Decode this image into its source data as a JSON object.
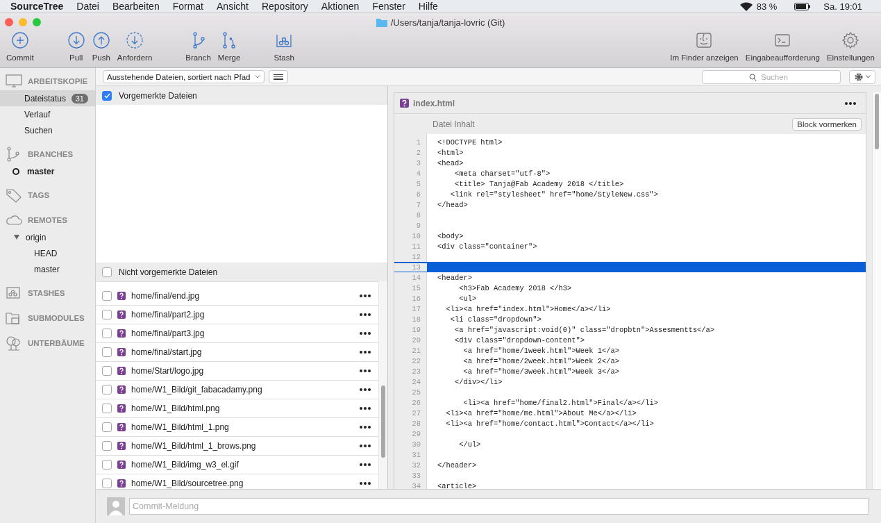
{
  "menubar": {
    "app": "SourceTree",
    "menus": [
      "Datei",
      "Bearbeiten",
      "Format",
      "Ansicht",
      "Repository",
      "Aktionen",
      "Fenster",
      "Hilfe"
    ],
    "battery": "83 %",
    "clock": "Sa. 19:01"
  },
  "window": {
    "title": "/Users/tanja/tanja-lovric (Git)"
  },
  "toolbar": {
    "left": [
      {
        "kind": "commit",
        "label": "Commit"
      },
      {
        "kind": "gap"
      },
      {
        "kind": "pull",
        "label": "Pull"
      },
      {
        "kind": "push",
        "label": "Push"
      },
      {
        "kind": "fetch",
        "label": "Anfordern"
      },
      {
        "kind": "gap"
      },
      {
        "kind": "branch",
        "label": "Branch"
      },
      {
        "kind": "merge",
        "label": "Merge"
      },
      {
        "kind": "gap"
      },
      {
        "kind": "stash",
        "label": "Stash"
      }
    ],
    "right": [
      {
        "kind": "finder",
        "label": "Im Finder anzeigen"
      },
      {
        "kind": "terminal",
        "label": "Eingabeaufforderung"
      },
      {
        "kind": "settings",
        "label": "Einstellungen"
      }
    ]
  },
  "sidebar": [
    {
      "kind": "workspace",
      "title": "ARBEITSKOPIE",
      "items": [
        {
          "label": "Dateistatus",
          "badge": "31",
          "selected": true
        },
        {
          "label": "Verlauf",
          "selected": false
        },
        {
          "label": "Suchen",
          "selected": false
        }
      ]
    },
    {
      "kind": "branches",
      "title": "BRANCHES",
      "items": [
        {
          "label": "master",
          "selected": false,
          "current": true
        }
      ]
    },
    {
      "kind": "tags",
      "title": "TAGS"
    },
    {
      "kind": "remotes",
      "title": "REMOTES",
      "items": [
        {
          "label": "origin",
          "selected": false,
          "expanded": true,
          "children": [
            {
              "label": "HEAD",
              "selected": false
            },
            {
              "label": "master",
              "selected": false
            }
          ]
        }
      ]
    },
    {
      "kind": "stashes",
      "title": "STASHES"
    },
    {
      "kind": "submodules",
      "title": "SUBMODULES"
    },
    {
      "kind": "subtrees",
      "title": "UNTERBÄUME"
    }
  ],
  "filter": {
    "dropdown": "Ausstehende Dateien, sortiert nach Pfad",
    "search_placeholder": "Suchen"
  },
  "staged": {
    "title": "Vorgemerkte Dateien",
    "checked": true
  },
  "unstaged": {
    "title": "Nicht vorgemerkte Dateien",
    "checked": false,
    "files": [
      {
        "path": "home/final/end.jpg",
        "checked": false
      },
      {
        "path": "home/final/part2.jpg",
        "checked": false
      },
      {
        "path": "home/final/part3.jpg",
        "checked": false
      },
      {
        "path": "home/final/start.jpg",
        "checked": false
      },
      {
        "path": "home/Start/logo.jpg",
        "checked": false
      },
      {
        "path": "home/W1_Bild/git_fabacadamy.png",
        "checked": false
      },
      {
        "path": "home/W1_Bild/html.png",
        "checked": false
      },
      {
        "path": "home/W1_Bild/html_1.png",
        "checked": false
      },
      {
        "path": "home/W1_Bild/html_1_brows.png",
        "checked": false
      },
      {
        "path": "home/W1_Bild/img_w3_el.gif",
        "checked": false
      },
      {
        "path": "home/W1_Bild/sourcetree.png",
        "checked": false
      }
    ]
  },
  "diff": {
    "filename": "index.html",
    "header": "Datei Inhalt",
    "button": "Block vormerken",
    "lines": [
      {
        "number": "1",
        "text": "<!DOCTYPE html>",
        "selected": false
      },
      {
        "number": "2",
        "text": "<html>",
        "selected": false
      },
      {
        "number": "3",
        "text": "<head>",
        "selected": false
      },
      {
        "number": "4",
        "text": "    <meta charset=\"utf-8\">",
        "selected": false
      },
      {
        "number": "5",
        "text": "    <title> Tanja@Fab Academy 2018 </title>",
        "selected": false
      },
      {
        "number": "6",
        "text": "   <link rel=\"stylesheet\" href=\"home/StyleNew.css\">",
        "selected": false
      },
      {
        "number": "7",
        "text": "</head>",
        "selected": false
      },
      {
        "number": "8",
        "selected": false
      },
      {
        "number": "9",
        "selected": false
      },
      {
        "number": "10",
        "text": "<body>",
        "selected": false
      },
      {
        "number": "11",
        "text": "<div class=\"container\">",
        "selected": false
      },
      {
        "number": "12",
        "selected": false
      },
      {
        "number": "13",
        "selected": true
      },
      {
        "number": "14",
        "text": "<header>",
        "selected": false
      },
      {
        "number": "15",
        "text": "     <h3>Fab Academy 2018 </h3>",
        "selected": false
      },
      {
        "number": "16",
        "text": "     <ul>",
        "selected": false
      },
      {
        "number": "17",
        "text": "  <li><a href=\"index.html\">Home</a></li>",
        "selected": false
      },
      {
        "number": "18",
        "text": "   <li class=\"dropdown\">",
        "selected": false
      },
      {
        "number": "19",
        "text": "    <a href=\"javascript:void(0)\" class=\"dropbtn\">Assesmentts</a>",
        "selected": false
      },
      {
        "number": "20",
        "text": "    <div class=\"dropdown-content\">",
        "selected": false
      },
      {
        "number": "21",
        "text": "      <a href=\"home/1week.html\">Week 1</a>",
        "selected": false
      },
      {
        "number": "22",
        "text": "      <a href=\"home/2week.html\">Week 2</a>",
        "selected": false
      },
      {
        "number": "23",
        "text": "      <a href=\"home/3week.html\">Week 3</a>",
        "selected": false
      },
      {
        "number": "24",
        "text": "    </div></li>",
        "selected": false
      },
      {
        "number": "25",
        "selected": false
      },
      {
        "number": "26",
        "text": "      <li><a href=\"home/final2.html\">Final</a></li>",
        "selected": false
      },
      {
        "number": "27",
        "text": "  <li><a href=\"home/me.html\">About Me</a></li>",
        "selected": false
      },
      {
        "number": "28",
        "text": "  <li><a href=\"home/contact.html\">Contact</a></li>",
        "selected": false
      },
      {
        "number": "29",
        "selected": false
      },
      {
        "number": "30",
        "text": "     </ul>",
        "selected": false
      },
      {
        "number": "31",
        "selected": false
      },
      {
        "number": "32",
        "text": "</header>",
        "selected": false
      },
      {
        "number": "33",
        "selected": false
      },
      {
        "number": "34",
        "text": "<article>",
        "selected": false
      }
    ]
  },
  "commit": {
    "placeholder": "Commit-Meldung"
  }
}
